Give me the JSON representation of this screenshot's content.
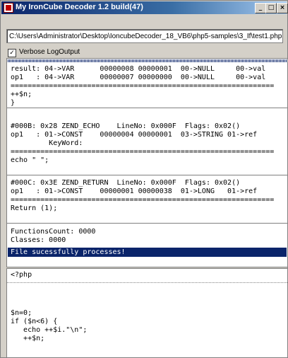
{
  "window": {
    "title": "My IronCube Decoder 1.2 build(47)",
    "buttons": {
      "minimize": "_",
      "maximize": "□",
      "close": "×"
    }
  },
  "path": "C:\\Users\\Administrator\\Desktop\\IoncubeDecoder_18_VB6\\php5-samples\\3_If\\test1.php",
  "verbose": {
    "label": "Verbose LogOutput",
    "checked": true,
    "check_glyph": "✓"
  },
  "log": {
    "blocks": [
      "result: 04->VAR      00000008 00000001  00->NULL     00->val\nop1   : 04->VAR      00000007 00000000  00->NULL     00->val\n==============================================================\n++$n;\n}",
      "#000B: 0x28 ZEND_ECHO    LineNo: 0x000F  Flags: 0x02()\nop1   : 01->CONST    00000004 00000001  03->STRING 01->ref\n         KeyWord:\n==============================================================\necho \" \";",
      "#000C: 0x3E ZEND_RETURN  LineNo: 0x000F  Flags: 0x02()\nop1   : 01->CONST    00000001 00000038  01->LONG   01->ref\n==============================================================\nReturn (1);",
      "FunctionsCount: 0000\nClasses: 0000"
    ],
    "status": "File sucessfully processes!"
  },
  "code": {
    "header": "<?php",
    "body": "\n\n\n$n=0;\nif ($n<6) {\n   echo ++$i.\"\\n\";\n   ++$n;"
  }
}
